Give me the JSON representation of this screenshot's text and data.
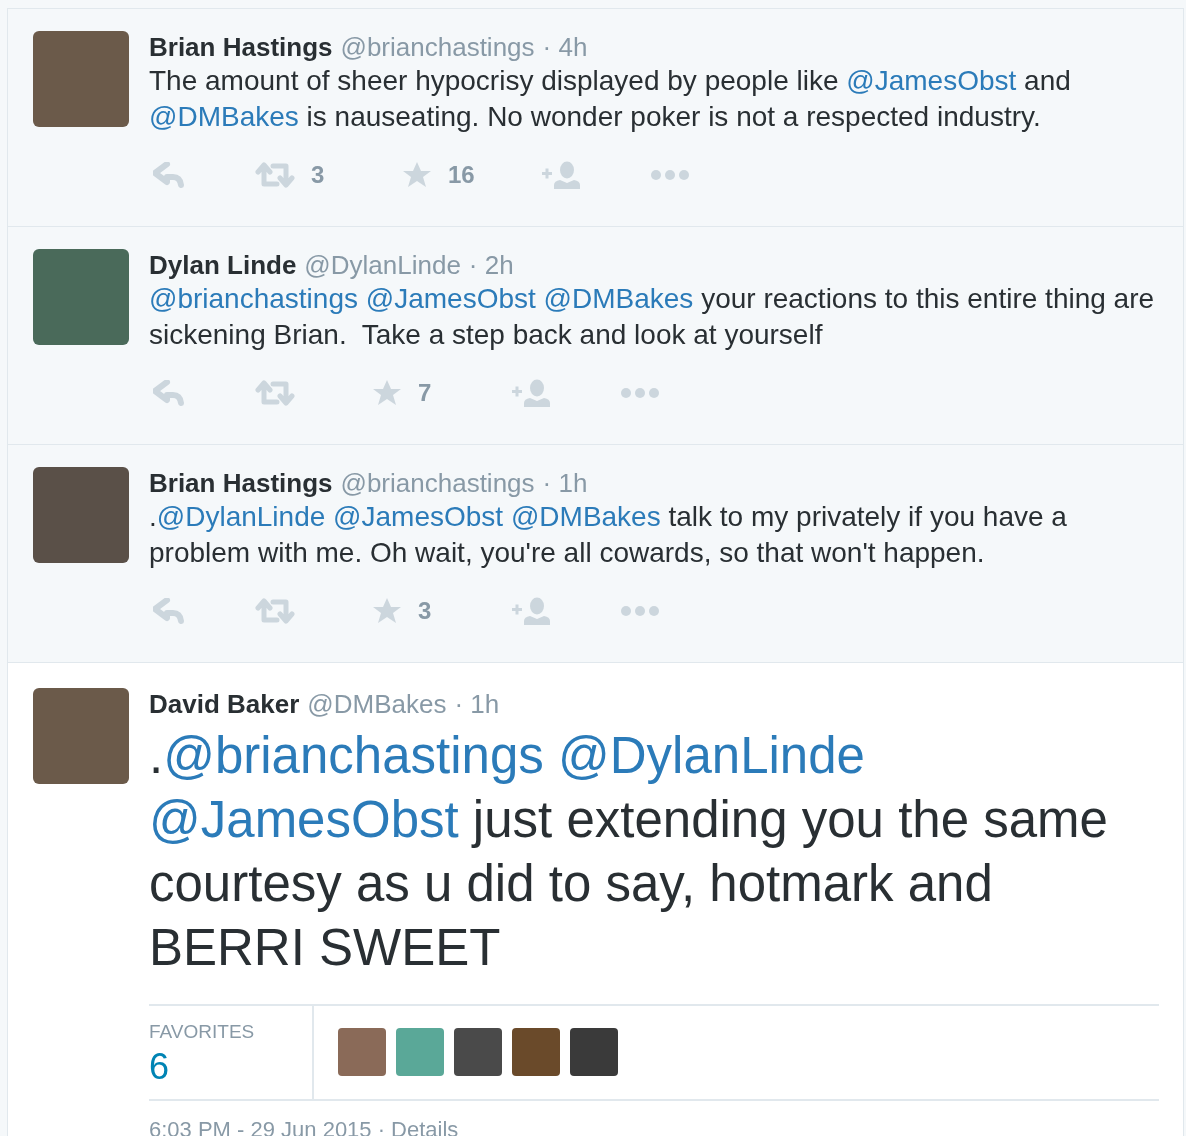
{
  "tweets": [
    {
      "kind": "reply",
      "name": "Brian Hastings",
      "handle": "@brianchastings",
      "time": "· 4h",
      "segments": [
        {
          "kind": "text",
          "text": "The amount of sheer hypocrisy displayed by people like "
        },
        {
          "kind": "mention",
          "text": "@JamesObst"
        },
        {
          "kind": "text",
          "text": " and "
        },
        {
          "kind": "mention",
          "text": "@DMBakes"
        },
        {
          "kind": "text",
          "text": " is nauseating. No wonder poker is not a respected industry."
        }
      ],
      "retweets": "3",
      "favorites": "16"
    },
    {
      "kind": "reply",
      "name": "Dylan Linde",
      "handle": "@DylanLinde",
      "time": "· 2h",
      "segments": [
        {
          "kind": "mention",
          "text": "@brianchastings"
        },
        {
          "kind": "mention",
          "text": "@JamesObst"
        },
        {
          "kind": "mention",
          "text": "@DMBakes"
        },
        {
          "kind": "text",
          "text": " your reactions to this entire thing are sickening Brian.  Take a step back and look at yourself"
        }
      ],
      "favorites": "7"
    },
    {
      "kind": "reply",
      "name": "Brian Hastings",
      "handle": "@brianchastings",
      "time": "· 1h",
      "segments": [
        {
          "kind": "text",
          "text": "."
        },
        {
          "kind": "mention",
          "text": "@DylanLinde"
        },
        {
          "kind": "mention",
          "text": "@JamesObst"
        },
        {
          "kind": "mention",
          "text": "@DMBakes"
        },
        {
          "kind": "text",
          "text": " talk to my privately if you have a problem with me. Oh wait, you're all cowards, so that won't happen."
        }
      ],
      "favorites": "3"
    },
    {
      "kind": "focused",
      "name": "David Baker",
      "handle": "@DMBakes",
      "time": "· 1h",
      "segments": [
        {
          "kind": "text",
          "text": "."
        },
        {
          "kind": "mention",
          "text": "@brianchastings"
        },
        {
          "kind": "mention",
          "text": "@DylanLinde"
        },
        {
          "kind": "mention",
          "text": "@JamesObst"
        },
        {
          "kind": "text",
          "text": " just extending you the same courtesy as u did to say, hotmark and BERRI SWEET"
        }
      ],
      "stats": {
        "label": "FAVORITES",
        "count": "6"
      },
      "timestamp": "6:03 PM - 29 Jun 2015 ·",
      "details": "Details"
    }
  ]
}
